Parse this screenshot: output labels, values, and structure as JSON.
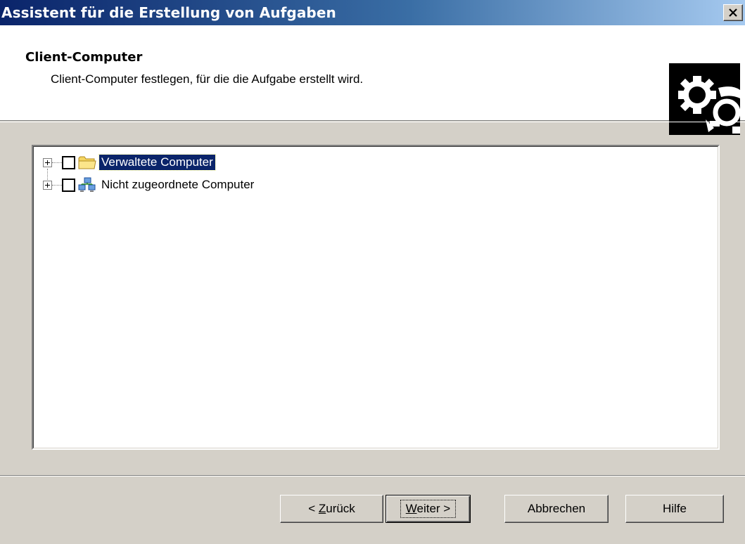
{
  "window": {
    "title": "Assistent für die Erstellung von Aufgaben"
  },
  "header": {
    "title": "Client-Computer",
    "subtitle": "Client-Computer festlegen, für die die Aufgabe erstellt wird.",
    "icon": "gears-icon"
  },
  "tree": {
    "items": [
      {
        "label": "Verwaltete Computer",
        "icon": "folder-icon",
        "checked": false,
        "selected": true
      },
      {
        "label": "Nicht zugeordnete Computer",
        "icon": "network-computers-icon",
        "checked": false,
        "selected": false
      }
    ]
  },
  "buttons": {
    "back_prefix": "< ",
    "back_mnemonic": "Z",
    "back_rest": "urück",
    "next_mnemonic": "W",
    "next_rest": "eiter >",
    "cancel": "Abbrechen",
    "help": "Hilfe"
  },
  "colors": {
    "titlebar_start": "#0a246a",
    "titlebar_end": "#a6caf0",
    "selection": "#0a246a",
    "face": "#d4d0c8"
  }
}
